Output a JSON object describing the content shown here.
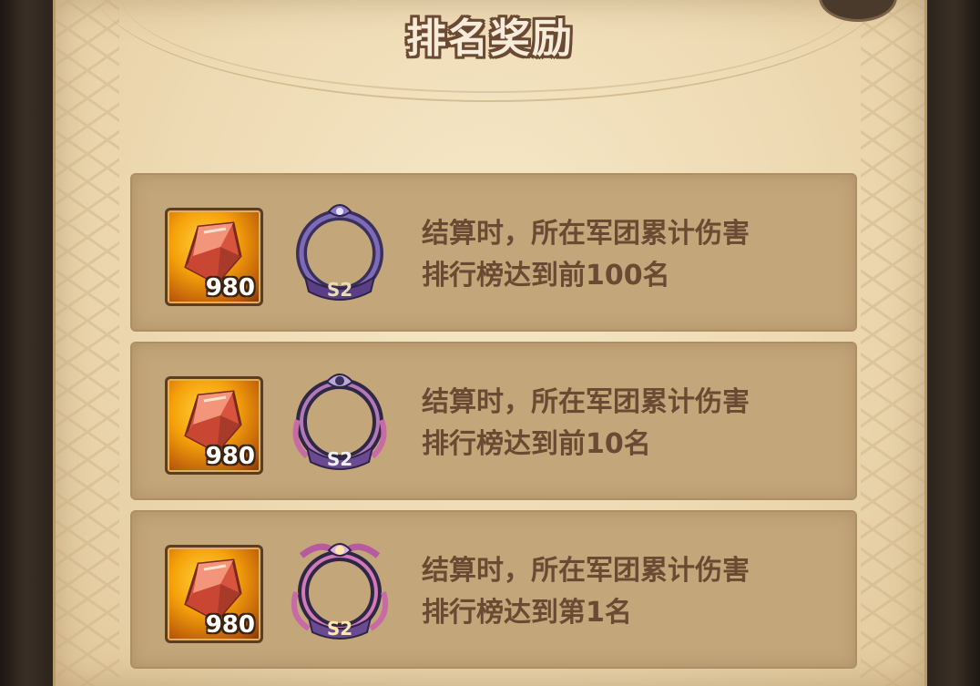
{
  "title": "排名奖励",
  "rewards": [
    {
      "item_count": "980",
      "badge_label": "S2",
      "desc_line1": "结算时，所在军团累计伤害",
      "desc_line2": "排行榜达到前100名"
    },
    {
      "item_count": "980",
      "badge_label": "S2",
      "desc_line1": "结算时，所在军团累计伤害",
      "desc_line2": "排行榜达到前10名"
    },
    {
      "item_count": "980",
      "badge_label": "S2",
      "desc_line1": "结算时，所在军团累计伤害",
      "desc_line2": "排行榜达到第1名"
    }
  ],
  "colors": {
    "panel": "#efdcb6",
    "row": "#c3a67a",
    "text": "#6b4a33"
  },
  "icons": [
    "gem-icon",
    "avatar-frame-icon"
  ]
}
